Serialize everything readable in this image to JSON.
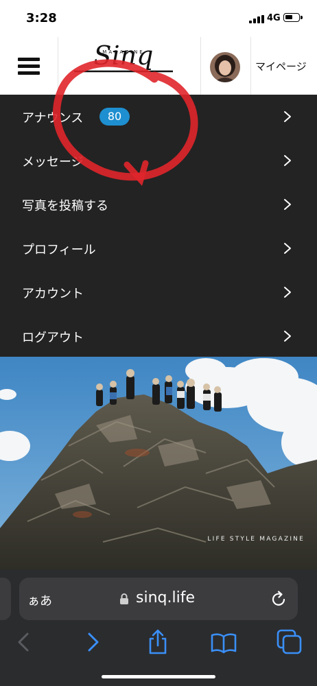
{
  "status_bar": {
    "time": "3:28",
    "network": "4G"
  },
  "header": {
    "logo_text": "Sinq",
    "logo_subtitle": "MAGAZINE",
    "mypage_label": "マイページ"
  },
  "menu": {
    "items": [
      {
        "label": "アナウンス",
        "badge": "80"
      },
      {
        "label": "メッセージ"
      },
      {
        "label": "写真を投稿する"
      },
      {
        "label": "プロフィール"
      },
      {
        "label": "アカウント"
      },
      {
        "label": "ログアウト"
      }
    ]
  },
  "hero": {
    "tagline": "LIFE STYLE MAGAZINE"
  },
  "browser": {
    "text_size_label": "ぁあ",
    "url": "sinq.life"
  },
  "colors": {
    "menu_bg": "#232323",
    "badge": "#1e8fd0",
    "annotation": "#e0262b",
    "safari_accent": "#3a8ff7"
  }
}
